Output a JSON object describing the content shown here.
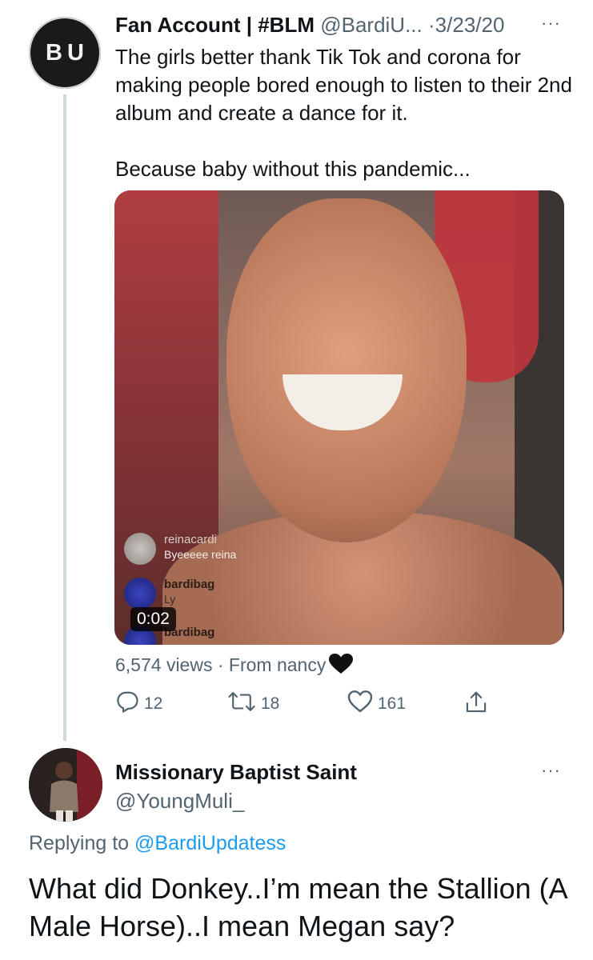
{
  "tweet1": {
    "avatar_initials": "BU",
    "display_name": "Fan Account | #BLM",
    "handle": "@BardiU...",
    "separator": "·",
    "date": "3/23/20",
    "more": "···",
    "text_line1": "The girls better thank Tik Tok and corona for making people bored enough to listen to their 2nd album and create a dance for it.",
    "text_line2": "Because baby without this pandemic...",
    "media": {
      "comments": [
        {
          "user": "reinacardi",
          "message": "Byeeeee reina"
        },
        {
          "user": "bardibag",
          "message": "Ly"
        },
        {
          "user": "bardibag",
          "message": ""
        }
      ],
      "duration": "0:02"
    },
    "views": "6,574 views",
    "source_sep": "·",
    "source": "From nancy",
    "reply_count": "12",
    "retweet_count": "18",
    "like_count": "161"
  },
  "tweet2": {
    "display_name": "Missionary Baptist Saint",
    "handle": "@YoungMuli_",
    "more": "···",
    "replying_prefix": "Replying to",
    "replying_to": "@BardiUpdatess",
    "text": "What did Donkey..I’m mean the Stallion (A Male Horse)..I mean Megan say?"
  },
  "colors": {
    "link": "#1d9bf0",
    "secondary_text": "#536471",
    "primary_text": "#0f1419",
    "thread_line": "#cfd9de"
  },
  "icons": [
    "more-icon",
    "reply-icon",
    "retweet-icon",
    "like-icon",
    "share-icon",
    "black-heart-icon"
  ]
}
